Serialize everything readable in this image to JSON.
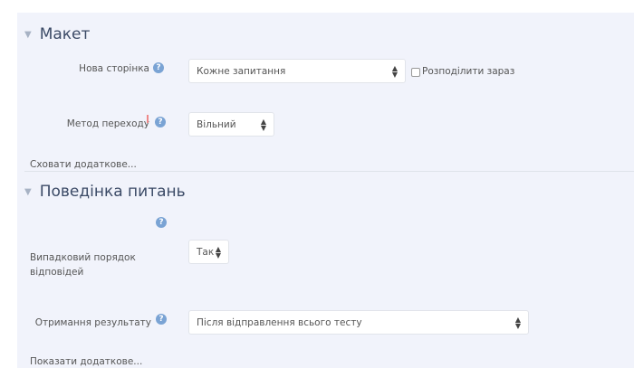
{
  "layout_section": {
    "title": "Макет",
    "new_page": {
      "label": "Нова сторінка",
      "value": "Кожне запитання",
      "checkbox_label": "Розподілити зараз"
    },
    "navigation_method": {
      "label": "Метод переходу",
      "value": "Вільний"
    },
    "hide_more_link": "Сховати додаткове..."
  },
  "behaviour_section": {
    "title": "Поведінка питань",
    "shuffle_answers": {
      "label": "Випадковий порядок відповідей",
      "value": "Так"
    },
    "feedback": {
      "label": "Отримання результату",
      "value": "Після відправлення всього тесту"
    },
    "show_more_link": "Показати додаткове..."
  },
  "icons": {
    "help": "question-circle-icon",
    "section_toggle": "caret-down-icon",
    "select_arrows": "updown-arrows-icon"
  },
  "colors": {
    "panel_bg": "#f1f3fb",
    "help_icon": "#7aa3d4",
    "heading": "#3b4a66"
  }
}
